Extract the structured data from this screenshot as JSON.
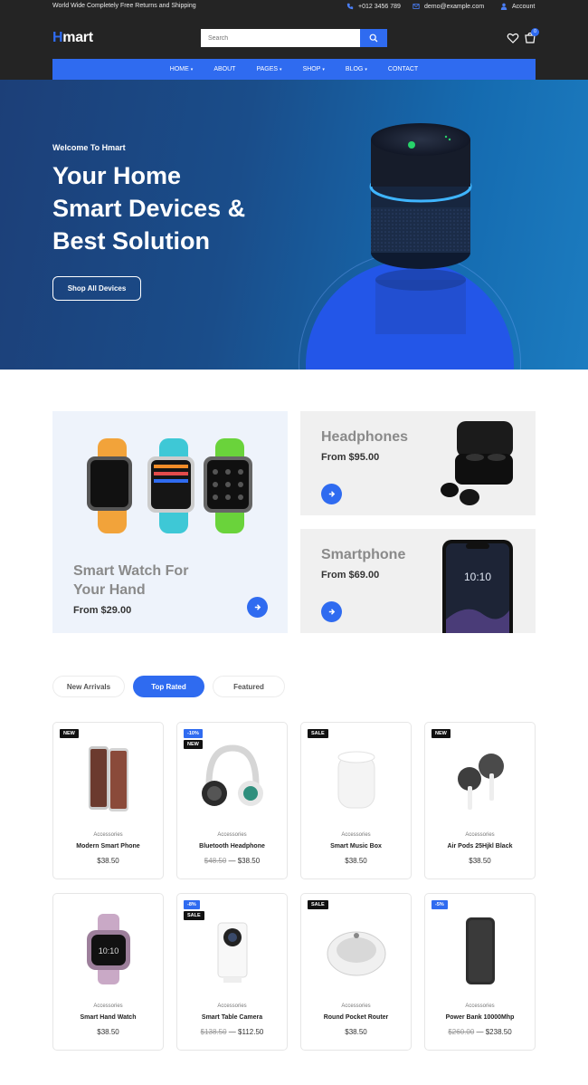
{
  "topbar": {
    "notice": "World Wide Completely Free Returns and Shipping",
    "phone": "+012 3456 789",
    "email": "demo@example.com",
    "account": "Account"
  },
  "header": {
    "logo_first": "H",
    "logo_rest": "mart",
    "search_placeholder": "Search",
    "cart_count": "0"
  },
  "nav": [
    {
      "label": "HOME",
      "dropdown": true
    },
    {
      "label": "ABOUT",
      "dropdown": false
    },
    {
      "label": "PAGES",
      "dropdown": true
    },
    {
      "label": "SHOP",
      "dropdown": true
    },
    {
      "label": "BLOG",
      "dropdown": true
    },
    {
      "label": "CONTACT",
      "dropdown": false
    }
  ],
  "hero": {
    "welcome": "Welcome To Hmart",
    "title_line1": "Your Home",
    "title_line2": "Smart Devices &",
    "title_line3": "Best Solution",
    "button": "Shop All Devices"
  },
  "banners": {
    "watch": {
      "title_line1": "Smart Watch For",
      "title_line2": "Your Hand",
      "price": "From $29.00"
    },
    "headphones": {
      "title": "Headphones",
      "price": "From $95.00"
    },
    "smartphone": {
      "title": "Smartphone",
      "price": "From $69.00",
      "screen_time": "10:10"
    }
  },
  "tabs": [
    "New Arrivals",
    "Top Rated",
    "Featured"
  ],
  "products": [
    {
      "category": "Accessories",
      "name": "Modern Smart Phone",
      "price": "$38.50",
      "old_price": "",
      "badges": [
        "NEW"
      ],
      "icon": "smartphone-image"
    },
    {
      "category": "Accessories",
      "name": "Bluetooth Headphone",
      "price": "$38.50",
      "old_price": "$48.50",
      "badges": [
        "-10%",
        "NEW"
      ],
      "icon": "headphone-image"
    },
    {
      "category": "Accessories",
      "name": "Smart Music Box",
      "price": "$38.50",
      "old_price": "",
      "badges": [
        "SALE"
      ],
      "icon": "music-box-image"
    },
    {
      "category": "Accessories",
      "name": "Air Pods 25Hjkl Black",
      "price": "$38.50",
      "old_price": "",
      "badges": [
        "NEW"
      ],
      "icon": "earbuds-image"
    },
    {
      "category": "Accessories",
      "name": "Smart Hand Watch",
      "price": "$38.50",
      "old_price": "",
      "badges": [],
      "icon": "watch-image",
      "screen_time": "10:10"
    },
    {
      "category": "Accessories",
      "name": "Smart Table Camera",
      "price": "$112.50",
      "old_price": "$138.50",
      "badges": [
        "-8%",
        "SALE"
      ],
      "icon": "camera-image"
    },
    {
      "category": "Accessories",
      "name": "Round Pocket Router",
      "price": "$38.50",
      "old_price": "",
      "badges": [
        "SALE"
      ],
      "icon": "router-image"
    },
    {
      "category": "Accessories",
      "name": "Power Bank 10000Mhp",
      "price": "$238.50",
      "old_price": "$260.00",
      "badges": [
        "-5%"
      ],
      "icon": "power-bank-image"
    }
  ],
  "colors": {
    "accent": "#2f6bf0",
    "header_bg": "#242424",
    "badge_dark": "#111111"
  }
}
